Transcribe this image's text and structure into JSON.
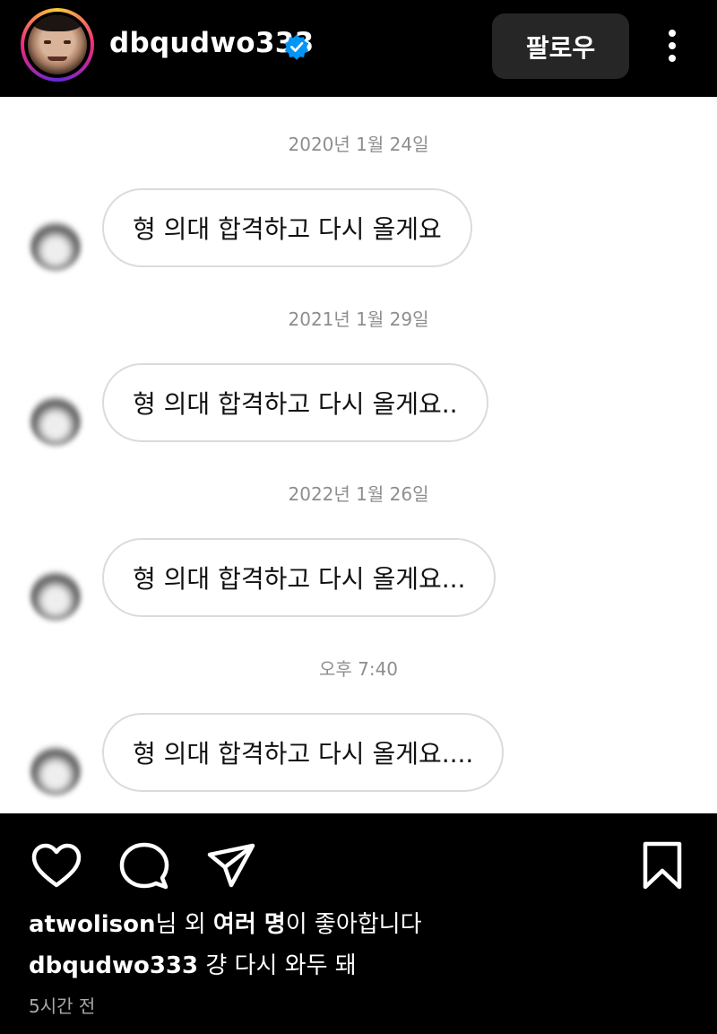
{
  "header": {
    "username": "dbqudwo333",
    "verified": true,
    "follow_label": "팔로우",
    "more_icon": "more-vertical-icon",
    "accent_color": "#0095f6"
  },
  "post": {
    "messages": [
      {
        "date": "2020년 1월 24일",
        "text": "형 의대 합격하고 다시 올게요"
      },
      {
        "date": "2021년 1월 29일",
        "text": "형 의대 합격하고 다시 올게요.."
      },
      {
        "date": "2022년 1월 26일",
        "text": "형 의대 합격하고 다시 올게요..."
      },
      {
        "date": "오후 7:40",
        "text": "형 의대 합격하고 다시 올게요...."
      }
    ]
  },
  "actions": {
    "icons": [
      "heart-icon",
      "comment-icon",
      "share-icon",
      "bookmark-icon"
    ]
  },
  "likes": {
    "user": "atwolison",
    "text_1": "님 외 ",
    "others": "여러 명",
    "text_2": "이 좋아합니다"
  },
  "caption": {
    "user": "dbqudwo333",
    "text": " 걍 다시 와두 돼"
  },
  "time_ago": "5시간 전"
}
